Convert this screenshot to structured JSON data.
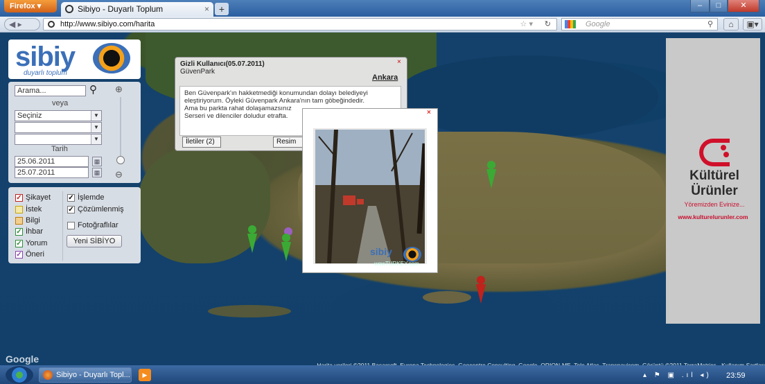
{
  "browser": {
    "app_button": "Firefox",
    "tab_title": "Sibiyo - Duyarlı Toplum",
    "url": "http://www.sibiyo.com/harita",
    "search_placeholder": "Google",
    "new_tab": "+"
  },
  "sidebar": {
    "logo_text": "sibiy",
    "logo_sub": "duyarlı toplum",
    "search_placeholder": "Arama...",
    "or_label": "veya",
    "select_value": "Seçiniz",
    "date_label": "Tarih",
    "date_from": "25.06.2011",
    "date_to": "25.07.2011",
    "categories": [
      {
        "label": "Şikayet",
        "checked": true
      },
      {
        "label": "İstek",
        "checked": false
      },
      {
        "label": "Bilgi",
        "checked": false
      },
      {
        "label": "İhbar",
        "checked": true
      },
      {
        "label": "Yorum",
        "checked": true
      },
      {
        "label": "Öneri",
        "checked": true
      }
    ],
    "statuses": [
      {
        "label": "İşlemde",
        "checked": true
      },
      {
        "label": "Çözümlenmiş",
        "checked": true
      }
    ],
    "photos_label": "Fotoğraflılar",
    "new_button": "Yeni SİBİYO"
  },
  "post": {
    "author": "Gizli Kullanıcı(05.07.2011)",
    "place": "GüvenPark",
    "city": "Ankara",
    "body_lines": [
      "Ben Güvenpark'ın hakketmediği konumundan dolayı belediyeyi",
      "eleştiriyorum. Öyleki Güvenpark Ankara'nın tam göbeğindedir.",
      "Ama bu parkta rahat dolaşamazsınız",
      "Serseri ve dilenciler doludur etrafta."
    ],
    "comments_button": "İletiler (2)",
    "photos_button": "Resim"
  },
  "photo": {
    "watermark": "sibiy",
    "watermark_sub": "wowTURKEY.com"
  },
  "map": {
    "credit": "Harita verileri ©2011 Basarsoft, Europa Technologies, Geocentre Consulting, Google, ORION-ME, Tele Atlas, Transnavicom, Görüntü ©2011 TerraMetrics - Kullanım Şartları",
    "google_logo": "Google"
  },
  "ad": {
    "line1": "Kültürel",
    "line2": "Ürünler",
    "slogan": "Yöremizden Evinize...",
    "url": "www.kulturelurunler.com"
  },
  "taskbar": {
    "firefox_item": "Sibiyo - Duyarlı Topl...",
    "clock": "23:59"
  },
  "colors": {
    "brand_blue": "#3b6fb8",
    "brand_orange": "#f4a019",
    "pin_green": "#3aaa35",
    "pin_red": "#c0221c",
    "ad_red": "#c8102e"
  }
}
